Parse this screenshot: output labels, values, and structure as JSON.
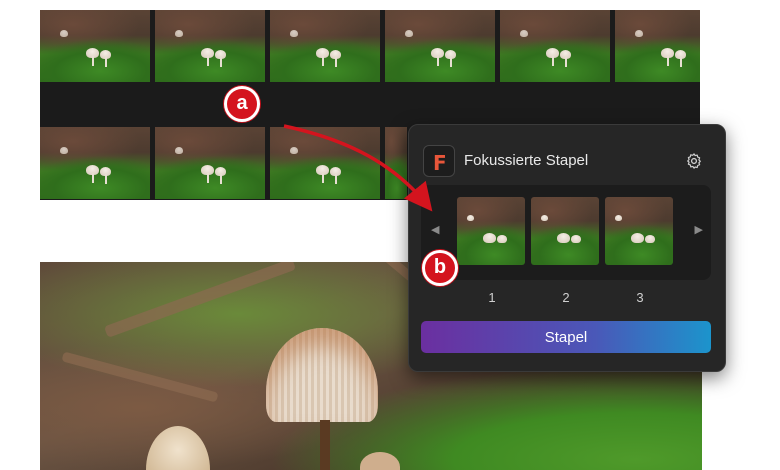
{
  "panel": {
    "title": "Fokussierte Stapel",
    "app_icon": "app-logo-f",
    "settings_icon": "gear-icon",
    "nav_prev_icon": "triangle-left-icon",
    "nav_next_icon": "triangle-right-icon",
    "frames": [
      {
        "label": "1"
      },
      {
        "label": "2"
      },
      {
        "label": "3"
      }
    ],
    "stack_button_label": "Stapel"
  },
  "callouts": {
    "a": "a",
    "b": "b"
  },
  "colors": {
    "callout_red": "#d4141e",
    "accent_logo": "#e8563a",
    "button_gradient_start": "#6b2fa0",
    "button_gradient_end": "#1c94cc"
  }
}
